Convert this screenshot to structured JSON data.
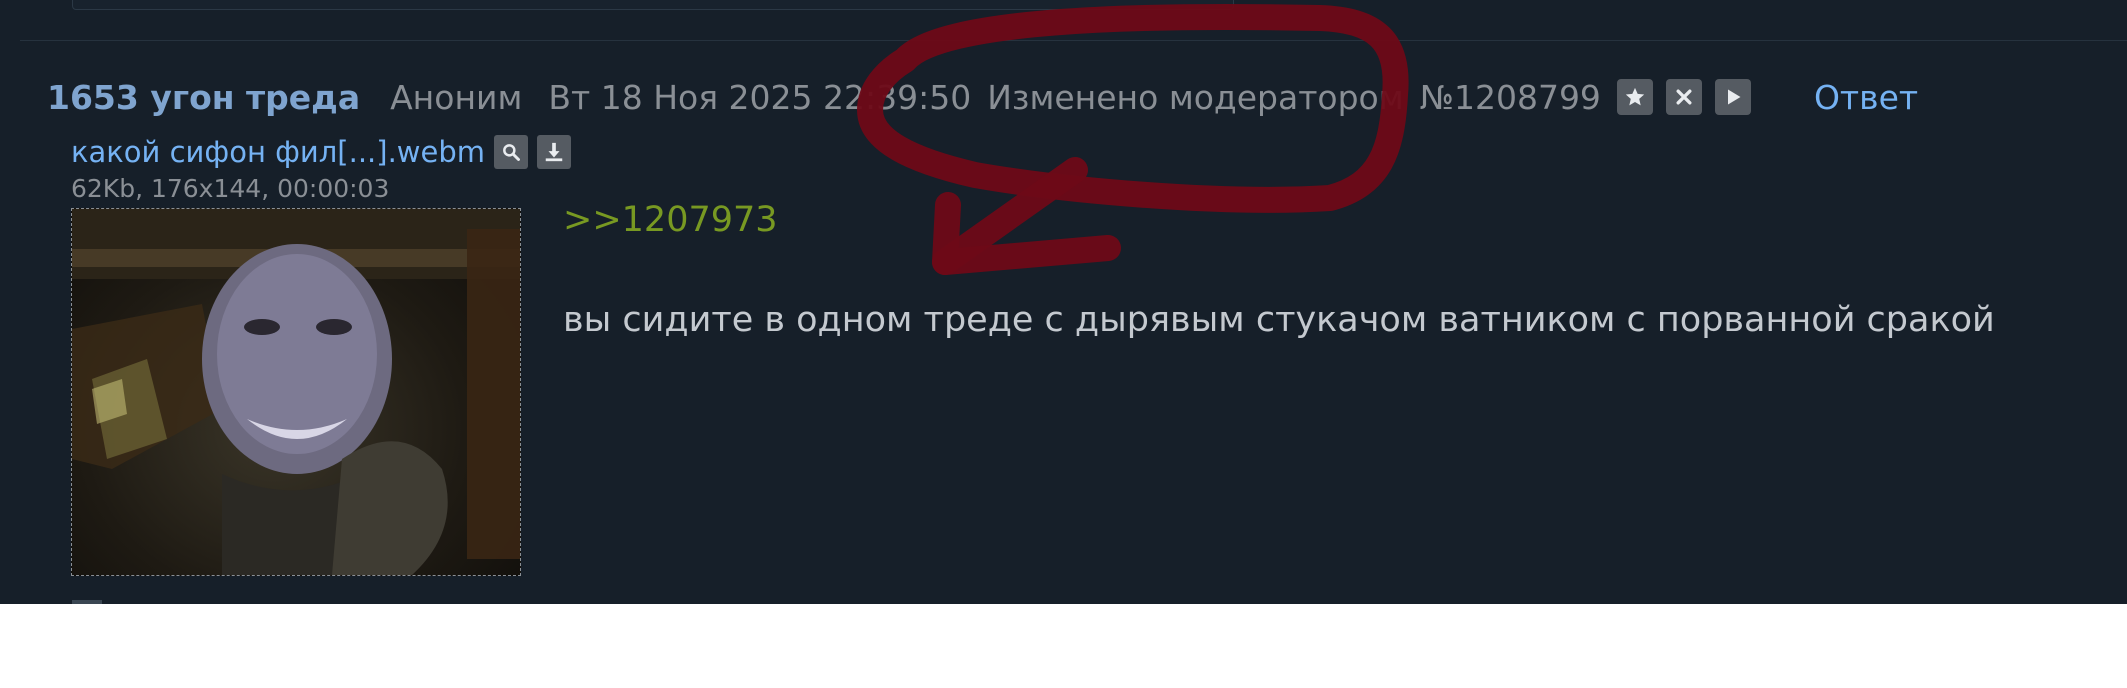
{
  "post": {
    "subject": "1653 угон треда",
    "name": "Аноним",
    "date": "Вт 18 Ноя 2025 22:39:50",
    "mod_note": "Изменено модератором",
    "number": "№1208799",
    "reply_label": "Ответ"
  },
  "file": {
    "name": "какой сифон фил[...].webm",
    "meta": "62Kb, 176x144, 00:00:03"
  },
  "message": {
    "quote": ">>1207973",
    "text": "вы сидите в одном треде с дырявым стукачом ватником с порванной сракой"
  },
  "icons": {
    "favorite": "star-icon",
    "hide": "close-icon",
    "menu": "play-icon",
    "search": "search-icon",
    "download": "download-icon"
  },
  "colors": {
    "background": "#161f29",
    "subject": "#7fa4cf",
    "link": "#75b2f3",
    "quote": "#789922",
    "meta": "#8a8f95",
    "text": "#c4c9cf",
    "annotation": "#6e0a17"
  }
}
